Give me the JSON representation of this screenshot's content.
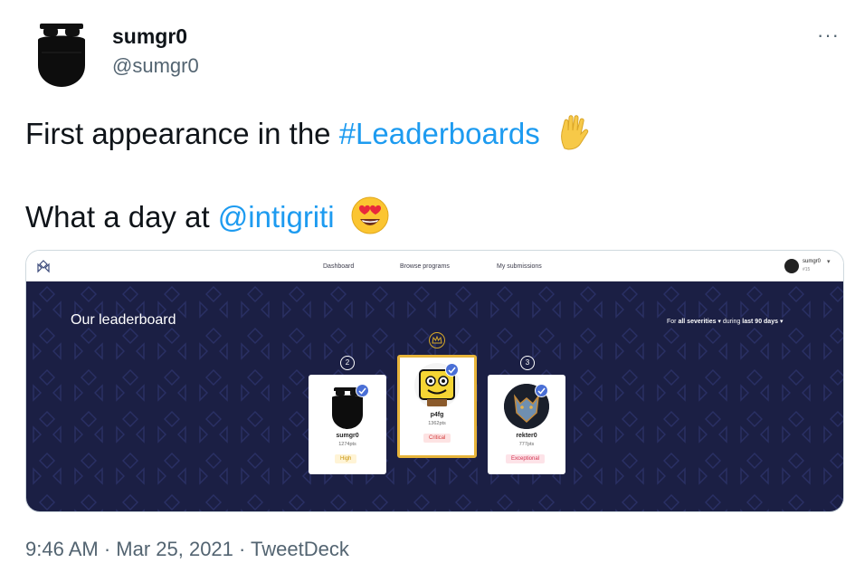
{
  "tweet": {
    "display_name": "sumgr0",
    "handle": "@sumgr0",
    "more_label": "···",
    "line1_prefix": "First appearance in the ",
    "line1_hashtag": "#Leaderboards",
    "line2_prefix": "What a day at ",
    "line2_mention": "@intigriti",
    "timestamp": "9:46 AM · Mar 25, 2021 · TweetDeck"
  },
  "icons": {
    "line1_emoji": "vulcan-salute-icon",
    "line2_emoji": "heart-eyes-icon",
    "avatar": "bearded-man-icon"
  },
  "embedded_app": {
    "nav": {
      "items": [
        "Dashboard",
        "Browse programs",
        "My submissions"
      ],
      "user_name": "sumgr0",
      "user_rank": "#15",
      "caret": "▾"
    },
    "board": {
      "title": "Our leaderboard",
      "filter_prefix": "For ",
      "filter_severity": "all severities",
      "filter_mid": " ▾ during ",
      "filter_period": "last 90 days",
      "filter_suffix": " ▾"
    },
    "ranks": [
      {
        "rank": "2",
        "name": "sumgr0",
        "points": "1274pts",
        "severity": "High"
      },
      {
        "rank": "1",
        "name": "p4fg",
        "points": "1362pts",
        "severity": "Critical"
      },
      {
        "rank": "3",
        "name": "rekter0",
        "points": "777pts",
        "severity": "Exceptional"
      }
    ]
  },
  "colors": {
    "link": "#1d9bf0",
    "board_bg": "#1b1f44",
    "gold": "#e7b43a"
  }
}
